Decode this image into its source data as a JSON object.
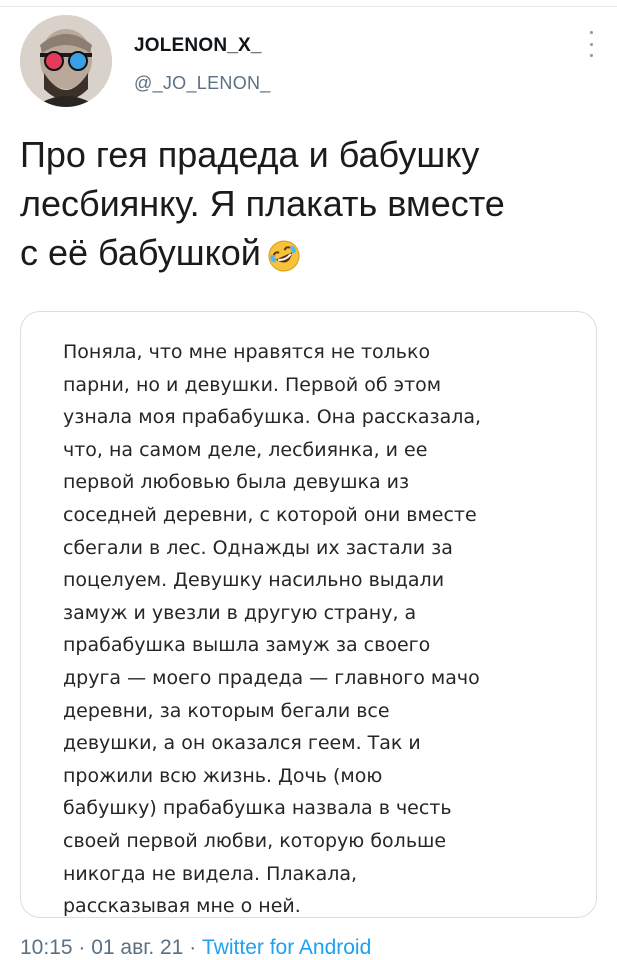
{
  "author": {
    "display_name": "JOLENON_X_",
    "handle": "@_JO_LENON_",
    "avatar_icon": "avatar-lenin-3d-glasses"
  },
  "tweet": {
    "text": "Про гея прадеда и бабушку\nлесбиянку. Я плакать вместе\nс её бабушкой",
    "emoji": "rolling-on-floor-laughing-emoji"
  },
  "media": {
    "text": "Поняла, что мне нравятся не только\nпарни, но и девушки. Первой об этом\nузнала моя прабабушка. Она рассказала,\nчто, на самом деле, лесбиянка, и ее\nпервой любовью была девушка из\nсоседней деревни, с которой они вместе\nсбегали в лес. Однажды их застали за\nпоцелуем. Девушку насильно выдали\nзамуж и увезли в другую страну, а\nпрабабушка вышла замуж за своего\nдруга — моего прадеда — главного мачо\nдеревни, за которым бегали все\nдевушки, а он оказался геем. Так и\nпрожили всю жизнь. Дочь (мою\nбабушку) прабабушка назвала в честь\nсвоей первой любви, которую больше\nникогда не видела. Плакала,\nрассказывая мне о ней."
  },
  "footer": {
    "time_date": "10:15 · 01 авг. 21 · ",
    "app": "Twitter for Android"
  },
  "colors": {
    "secondary_text": "#5b7083",
    "link": "#1da1f2",
    "border": "#d9dee2"
  }
}
